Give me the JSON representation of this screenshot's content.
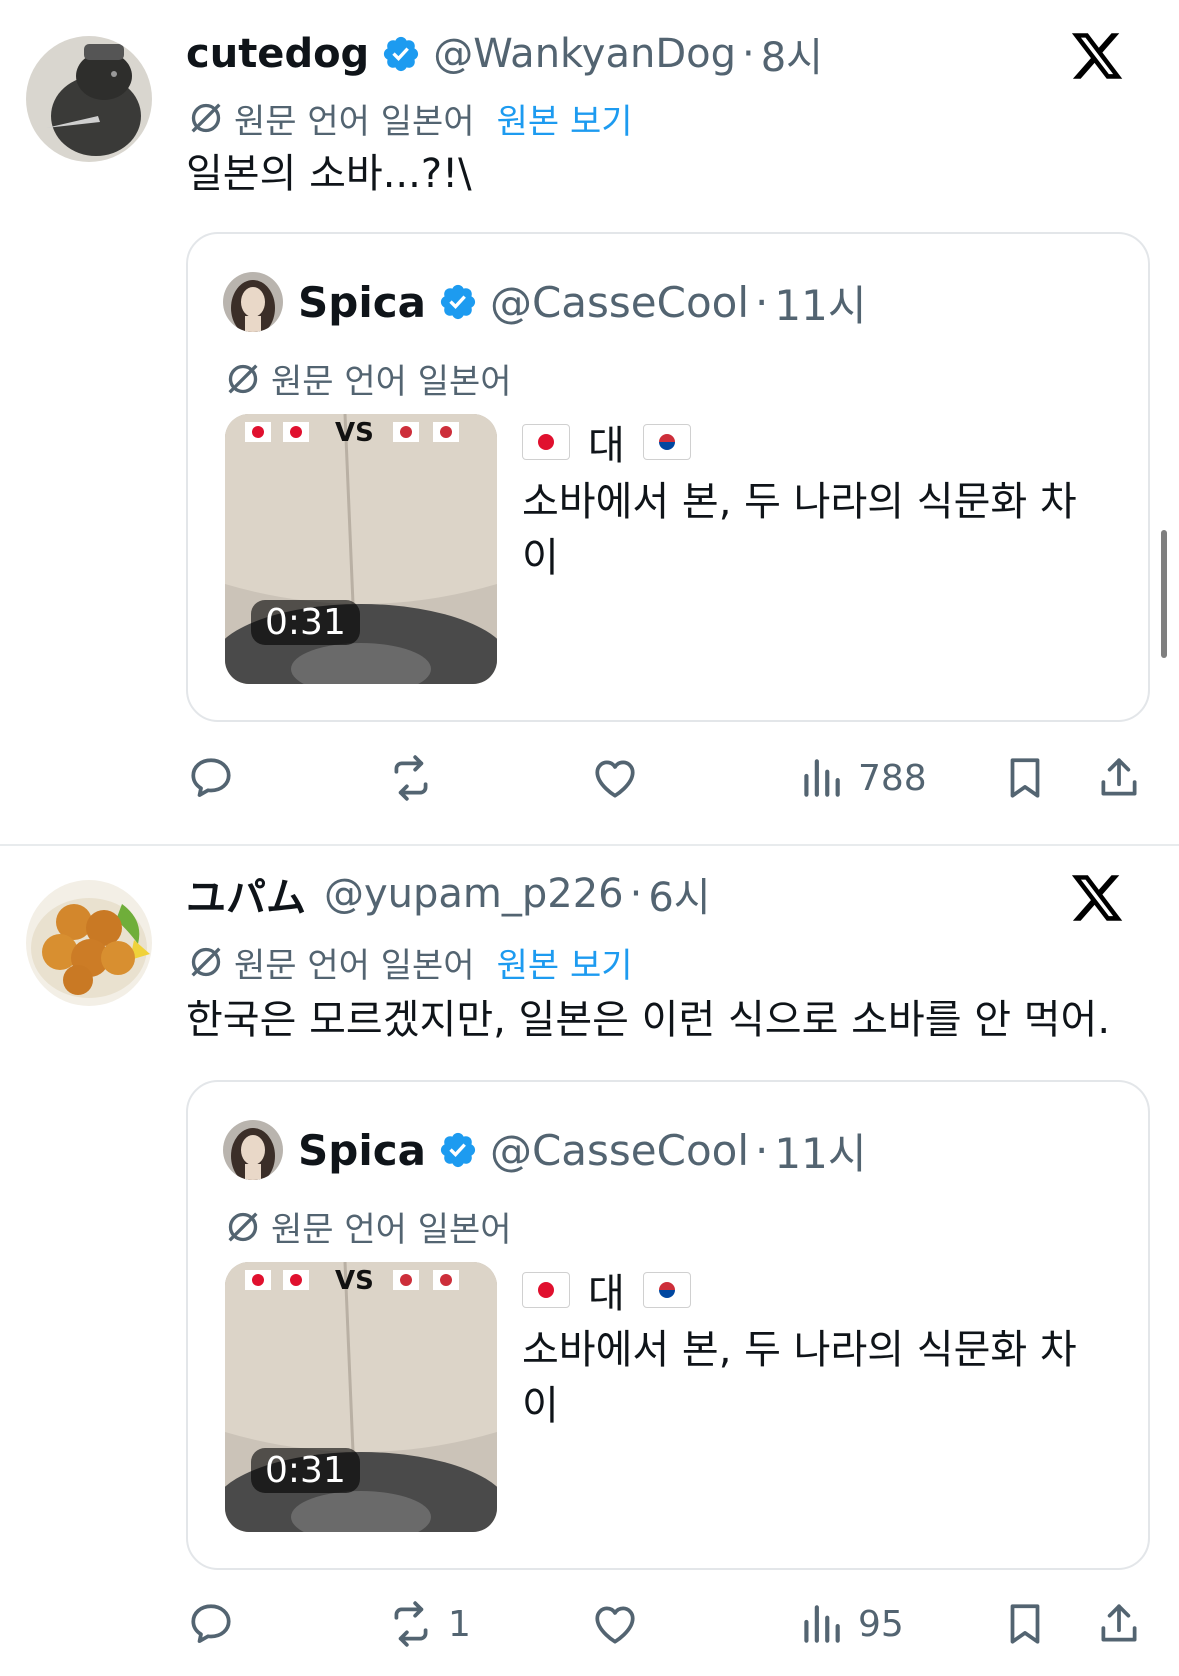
{
  "posts": [
    {
      "display_name": "cutedog",
      "verified": true,
      "handle": "@WankyanDog",
      "separator": "·",
      "time": "8시",
      "translation_label": "원문 언어 일본어",
      "view_original": "원본 보기",
      "text": "일본의 소바...?!\\",
      "quote": {
        "display_name": "Spica",
        "handle": "@CasseCool",
        "separator": "·",
        "time": "11시",
        "translation_label": "원문 언어 일본어",
        "thumb_overlay": "VS",
        "video_duration": "0:31",
        "flags_line_word": "대",
        "text": "소바에서 본, 두 나라의 식문화 차이"
      },
      "actions": {
        "replies": "",
        "reposts": "",
        "likes": "",
        "views": "788"
      }
    },
    {
      "display_name": "ユパム",
      "verified": false,
      "handle": "@yupam_p226",
      "separator": "·",
      "time": "6시",
      "translation_label": "원문 언어 일본어",
      "view_original": "원본 보기",
      "text": "한국은 모르겠지만, 일본은 이런 식으로 소바를 안 먹어.",
      "quote": {
        "display_name": "Spica",
        "handle": "@CasseCool",
        "separator": "·",
        "time": "11시",
        "translation_label": "원문 언어 일본어",
        "thumb_overlay": "VS",
        "video_duration": "0:31",
        "flags_line_word": "대",
        "text": "소바에서 본, 두 나라의 식문화 차이"
      },
      "actions": {
        "replies": "",
        "reposts": "1",
        "likes": "",
        "views": "95"
      }
    }
  ],
  "icons": {
    "verified": "verified-badge-icon",
    "x_logo": "x-logo-icon",
    "translate": "translate-icon",
    "reply": "reply-icon",
    "repost": "repost-icon",
    "like": "heart-icon",
    "views": "views-chart-icon",
    "bookmark": "bookmark-icon",
    "share": "share-icon"
  },
  "colors": {
    "accent": "#1d9bf0",
    "secondary_text": "#536471",
    "primary_text": "#0f1419"
  }
}
